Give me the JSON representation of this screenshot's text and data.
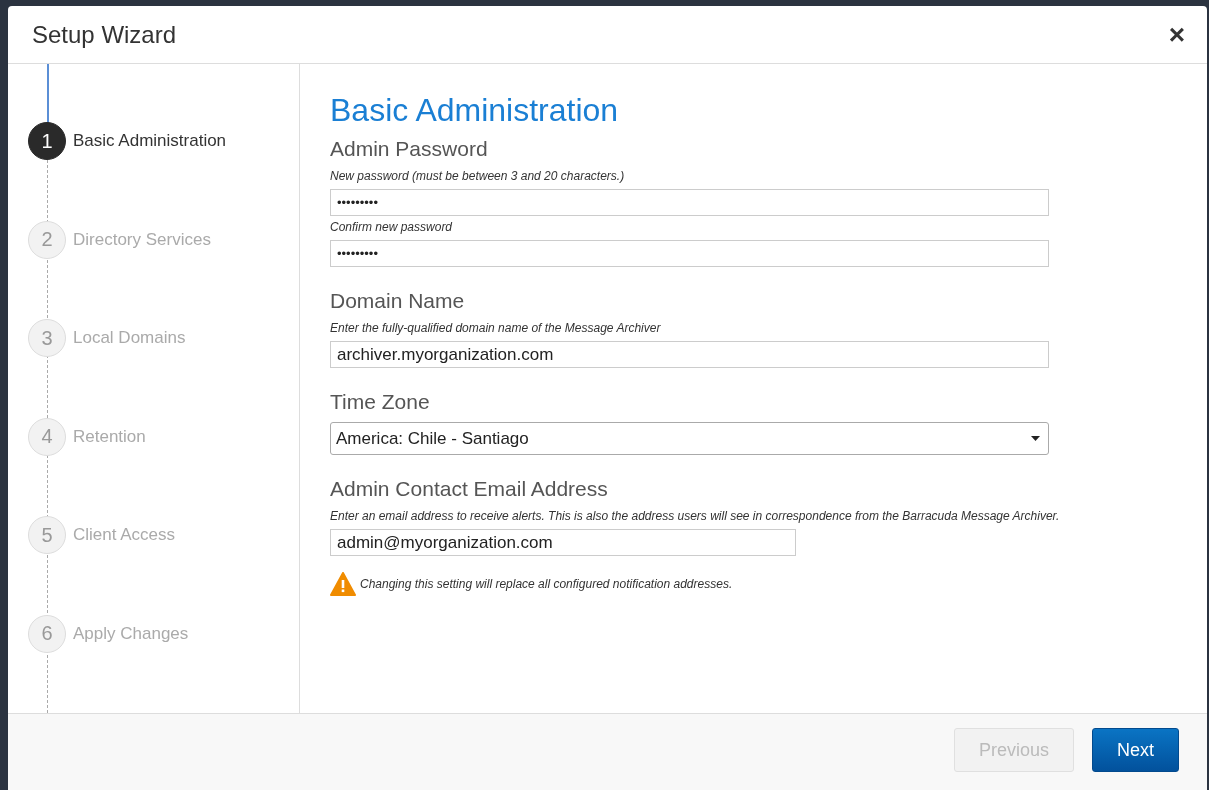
{
  "window": {
    "title": "Setup Wizard",
    "close": "×"
  },
  "steps": [
    {
      "number": "1",
      "label": "Basic Administration",
      "selected": true
    },
    {
      "number": "2",
      "label": "Directory Services",
      "selected": false
    },
    {
      "number": "3",
      "label": "Local Domains",
      "selected": false
    },
    {
      "number": "4",
      "label": "Retention",
      "selected": false
    },
    {
      "number": "5",
      "label": "Client Access",
      "selected": false
    },
    {
      "number": "6",
      "label": "Apply Changes",
      "selected": false
    }
  ],
  "page_title": "Basic Administration",
  "sections": [
    {
      "kind": "passwords",
      "heading": "Admin Password",
      "fields": [
        {
          "hint": "New password (must be between 3 and 20 characters.)",
          "value": "•••••••••"
        },
        {
          "hint": "Confirm new password",
          "value": "•••••••••"
        }
      ]
    },
    {
      "kind": "text",
      "heading": "Domain Name",
      "hint": "Enter the fully-qualified domain name of the Message Archiver",
      "value": "archiver.myorganization.com"
    },
    {
      "kind": "select",
      "heading": "Time Zone",
      "value": "America: Chile - Santiago"
    },
    {
      "kind": "email",
      "heading": "Admin Contact Email Address",
      "hint": "Enter an email address to receive alerts. This is also the address users will see in correspondence from the Barracuda Message Archiver.",
      "value": "admin@myorganization.com",
      "warning": "Changing this setting will replace all configured notification addresses."
    }
  ],
  "buttons": [
    {
      "label": "Previous",
      "disabled": true,
      "primary": false
    },
    {
      "label": "Next",
      "disabled": false,
      "primary": true
    }
  ]
}
